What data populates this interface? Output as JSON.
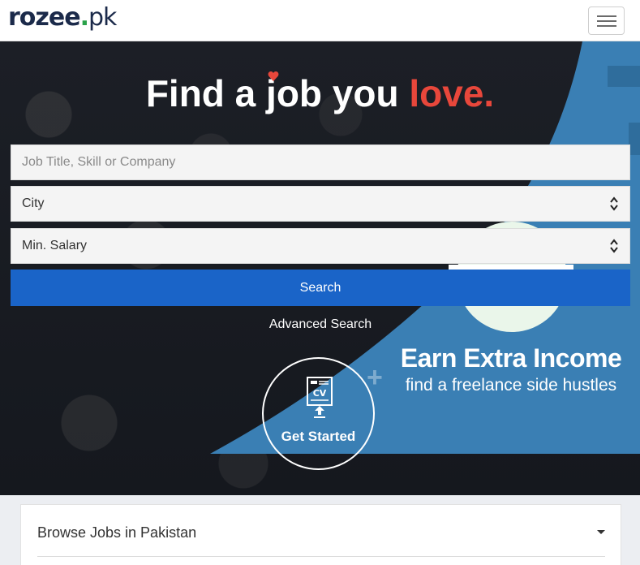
{
  "brand": {
    "logo_main": "rozee",
    "logo_dot": ".",
    "logo_tld": "pk"
  },
  "navbar": {
    "menu_icon": "hamburger-icon"
  },
  "hero": {
    "headline_prefix": "Find a job you ",
    "headline_accent": "love.",
    "accent_color": "#e8473b"
  },
  "search": {
    "keyword_placeholder": "Job Title, Skill or Company",
    "city_value": "City",
    "salary_value": "Min. Salary",
    "search_label": "Search",
    "advanced_label": "Advanced Search",
    "button_color": "#1a64c8"
  },
  "promo": {
    "headline": "Earn Extra Income",
    "subline": "find a freelance side hustles",
    "bg_color": "#3a7fb4"
  },
  "cv": {
    "label": "Get Started",
    "icon": "cv-upload-icon",
    "icon_text": "CV"
  },
  "browse": {
    "title": "Browse Jobs in Pakistan"
  }
}
